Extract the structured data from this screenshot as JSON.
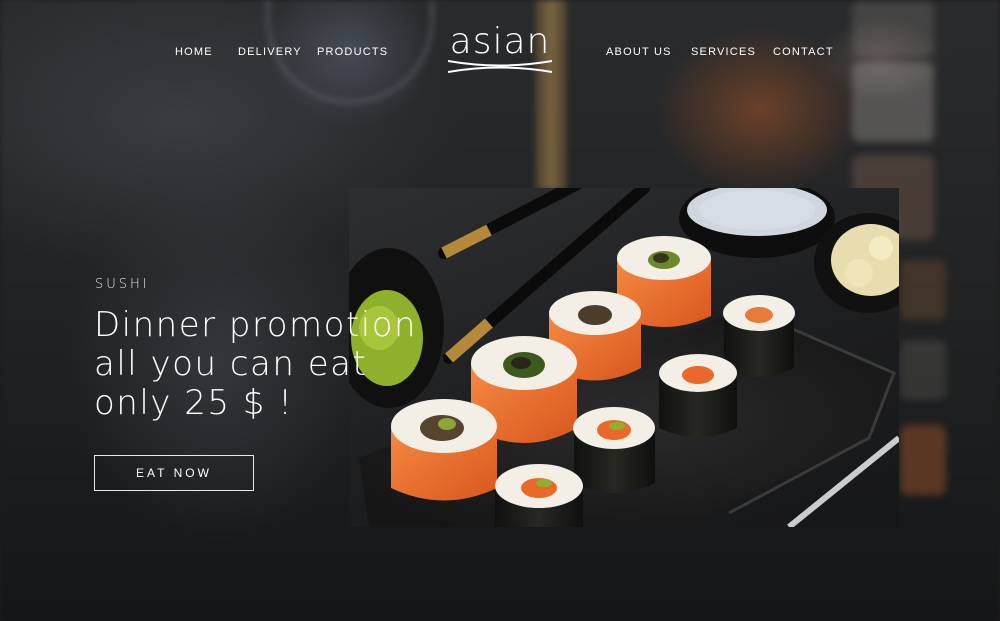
{
  "nav": {
    "left": [
      "HOME",
      "DELIVERY",
      "PRODUCTS"
    ],
    "right": [
      "ABOUT US",
      "SERVICES",
      "CONTACT"
    ],
    "logo_text": "asian"
  },
  "hero": {
    "kicker": "SUSHI",
    "title_lines": [
      "Dinner promotion",
      "all you can eat",
      "only 25 $ !"
    ],
    "cta_label": "EAT NOW"
  },
  "colors": {
    "background": "#1c1d1e",
    "text": "#ffffff",
    "salmon": "#e8692a",
    "rice": "#f1ece4",
    "nori": "#1b1c1a",
    "wasabi": "#8fb02a"
  }
}
